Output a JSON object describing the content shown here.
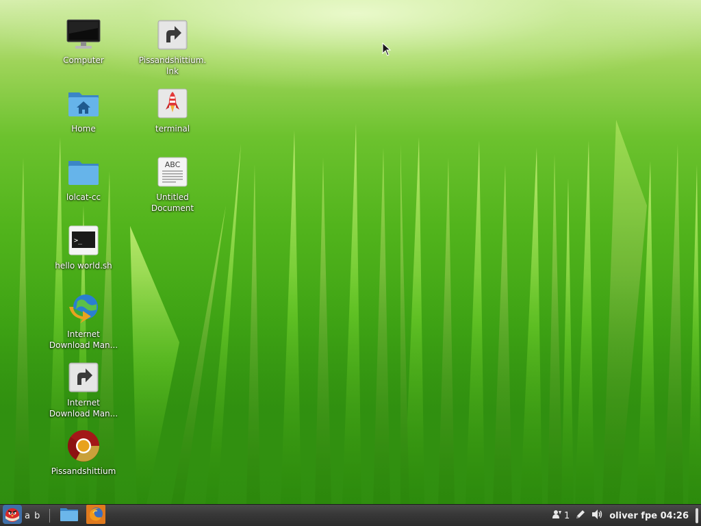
{
  "desktop": {
    "icons": [
      {
        "label": "Computer",
        "icon": "monitor-icon"
      },
      {
        "label": "Home",
        "icon": "home-folder-icon"
      },
      {
        "label": "lolcat-cc",
        "icon": "folder-icon"
      },
      {
        "label": "hello world.sh",
        "icon": "terminal-script-icon"
      },
      {
        "label": "Internet\nDownload Man...",
        "icon": "idm-globe-icon"
      },
      {
        "label": "Internet\nDownload Man...",
        "icon": "shortcut-arrow-icon"
      },
      {
        "label": "Pissandshittium",
        "icon": "chromium-icon"
      },
      {
        "label": "Pissandshittium.\nlnk",
        "icon": "shortcut-arrow-icon"
      },
      {
        "label": "terminal",
        "icon": "rocket-launcher-icon"
      },
      {
        "label": "Untitled\nDocument",
        "icon": "text-document-icon"
      }
    ],
    "document_icon_text": "ABC"
  },
  "panel": {
    "menu_label": "a b",
    "launchers": [
      {
        "name": "file-manager",
        "icon": "folder-icon"
      },
      {
        "name": "firefox",
        "icon": "firefox-icon"
      }
    ],
    "tray": {
      "notification_count": "1",
      "user_and_clock": "oliver fpe 04:26"
    }
  },
  "colors": {
    "panel_bg": "#383838",
    "label_text": "#ffffff",
    "folder_blue": "#5aa8e0",
    "grass_green": "#52b41c"
  }
}
